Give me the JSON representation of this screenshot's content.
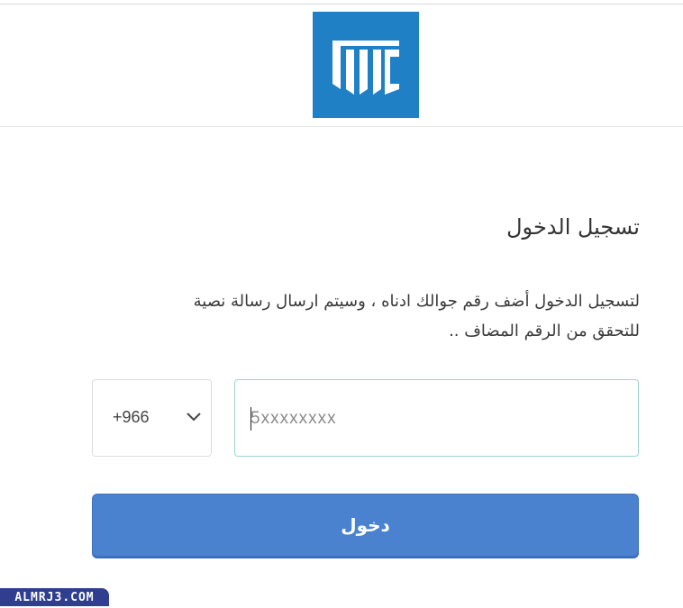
{
  "header": {
    "logo_text": "NTC",
    "logo_color": "#1f80c6"
  },
  "form": {
    "title": "تسجيل الدخول",
    "instruction_line1": "لتسجيل الدخول أضف رقم جوالك ادناه ، وسيتم ارسال رسالة نصية",
    "instruction_line2": "للتحقق من الرقم المضاف ..",
    "country_code": "+966",
    "phone_placeholder": "5xxxxxxxx",
    "submit_label": "دخول",
    "button_color": "#4a82d0"
  },
  "watermark": {
    "text": "ALMRJ3.COM"
  }
}
